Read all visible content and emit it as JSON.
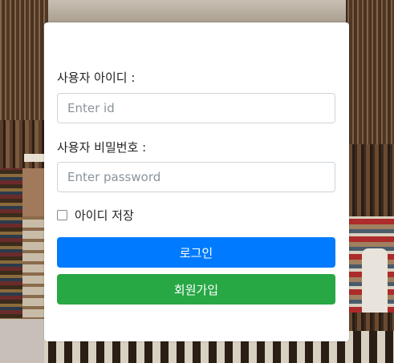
{
  "login_form": {
    "user_id_label": "사용자 아이디 :",
    "user_id_placeholder": "Enter id",
    "password_label": "사용자 비밀번호 :",
    "password_placeholder": "Enter password",
    "remember_id_label": "아이디 저장",
    "login_button": "로그인",
    "signup_button": "회원가입"
  },
  "colors": {
    "login_button": "#007bff",
    "signup_button": "#28a745",
    "card_background": "#ffffff"
  }
}
